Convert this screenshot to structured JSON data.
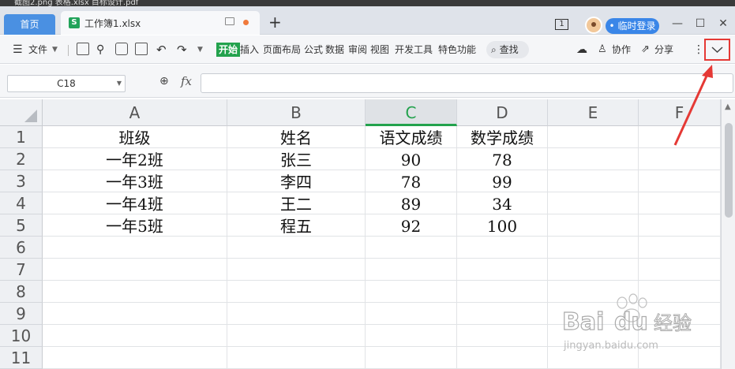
{
  "background_strip": "截图2.png      表格.xlsx    目标设计.pdf",
  "titlebar": {
    "home_tab": "首页",
    "doc_tab": "工作簿1.xlsx",
    "doc_icon": "S",
    "new_tab": "+",
    "window_count": "1",
    "login_button": "• 临时登录",
    "minimize": "—",
    "maximize": "☐",
    "close": "✕"
  },
  "toolbar": {
    "menu": "文件",
    "tabs": [
      "开始",
      "插入",
      "页面布局",
      "公式",
      "数据",
      "审阅",
      "视图",
      "开发工具",
      "特色功能"
    ],
    "active_tab": "开始",
    "search": "查找",
    "collaborate": "协作",
    "share": "分享",
    "more": "⋮",
    "collapse": "﹀"
  },
  "formula_bar": {
    "cell_ref": "C18",
    "fx": "fx",
    "value": ""
  },
  "sheet": {
    "columns": [
      "A",
      "B",
      "C",
      "D",
      "E",
      "F"
    ],
    "selected_column": "C",
    "rows": [
      "1",
      "2",
      "3",
      "4",
      "5",
      "6",
      "7",
      "8",
      "9",
      "10",
      "11"
    ],
    "cells": [
      [
        "班级",
        "姓名",
        "语文成绩",
        "数学成绩",
        "",
        ""
      ],
      [
        "一年2班",
        "张三",
        "90",
        "78",
        "",
        ""
      ],
      [
        "一年3班",
        "李四",
        "78",
        "99",
        "",
        ""
      ],
      [
        "一年4班",
        "王二",
        "89",
        "34",
        "",
        ""
      ],
      [
        "一年5班",
        "程五",
        "92",
        "100",
        "",
        ""
      ]
    ]
  },
  "watermark": {
    "brand": "Bai",
    "brand2": "du",
    "product": "经验",
    "url": "jingyan.baidu.com"
  },
  "colors": {
    "accent_green": "#23a24d",
    "tab_blue": "#4a90e2",
    "annotation_red": "#e53935"
  }
}
